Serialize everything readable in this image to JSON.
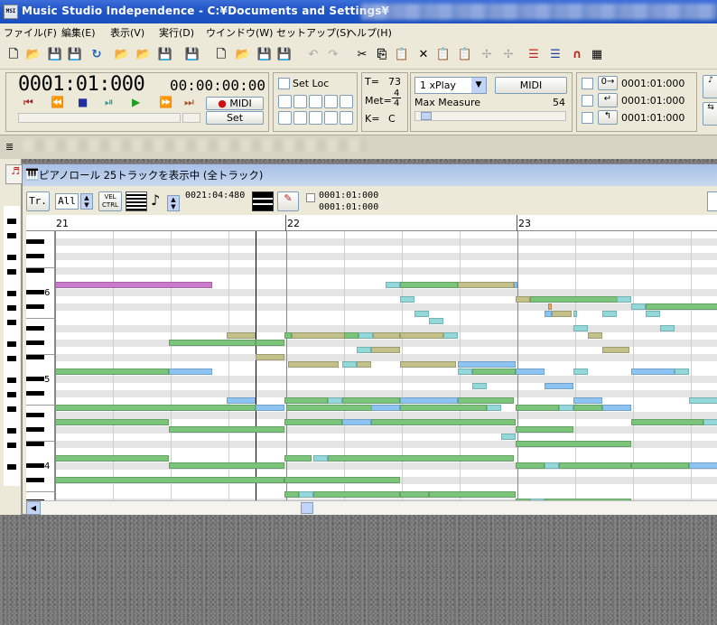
{
  "window": {
    "title": "Music Studio Independence - C:¥Documents and Settings¥"
  },
  "menu": [
    {
      "label": "ファイル(F)"
    },
    {
      "label": "編集(E)"
    },
    {
      "label": "表示(V)"
    },
    {
      "label": "実行(D)"
    },
    {
      "label": "ウインドウ(W)"
    },
    {
      "label": "セットアップ(S)"
    },
    {
      "label": "ヘルプ(H)"
    }
  ],
  "transport": {
    "counter": "0001:01:000",
    "timecode": "00:00:00:00",
    "midi_button": "● MIDI",
    "set_button": "Set",
    "setloc_label": "Set Loc",
    "tempo_label": "T=",
    "tempo_value": "73",
    "meter_label": "Met=",
    "meter_num": "4",
    "meter_den": "4",
    "key_label": "K=",
    "key_value": "C",
    "play_mode": "1 xPlay",
    "midi2_button": "MIDI",
    "max_measure_label": "Max Measure",
    "max_measure_value": "54",
    "loc1": "0001:01:000",
    "loc2": "0001:01:000",
    "loc3": "0001:01:000"
  },
  "piano_roll": {
    "title": "ピアノロール 25トラックを表示中 (全トラック)",
    "tr_button": "Tr.",
    "all_select": "All",
    "vel_button": "VEL CTRL",
    "position": "0021:04:480",
    "range_start": "0001:01:000",
    "range_end": "0001:01:000",
    "measures": [
      "21",
      "22",
      "23"
    ],
    "octave_labels": [
      "6",
      "5",
      "4"
    ]
  },
  "colors": {
    "green": "#7cc47c",
    "blue": "#8cc4f4",
    "teal": "#92d8d8",
    "olive": "#c0c088",
    "magenta": "#cc7acc",
    "orange": "#e0a860",
    "lane_gray": "#e4e4e4"
  }
}
